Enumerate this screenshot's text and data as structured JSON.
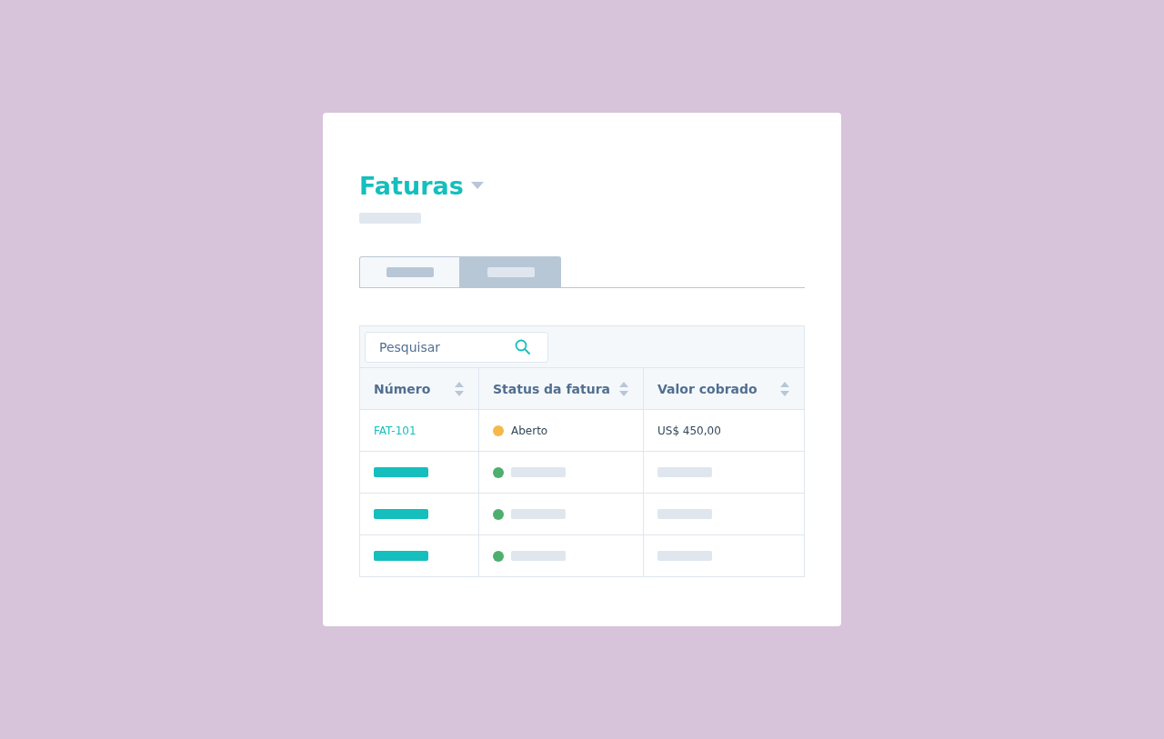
{
  "title": "Faturas",
  "tabs": [
    {
      "selected": false
    },
    {
      "selected": true
    }
  ],
  "search": {
    "placeholder": "Pesquisar"
  },
  "table": {
    "columns": [
      "Número",
      "Status da fatura",
      "Valor cobrado"
    ],
    "rows": [
      {
        "kind": "text",
        "number": "FAT-101",
        "status": "Aberto",
        "color": "#f5b94b",
        "amount": "US$ 450,00"
      },
      {
        "kind": "skeleton",
        "color": "#4caf6e"
      },
      {
        "kind": "skeleton",
        "color": "#4caf6e"
      },
      {
        "kind": "skeleton",
        "color": "#4caf6e"
      }
    ]
  }
}
